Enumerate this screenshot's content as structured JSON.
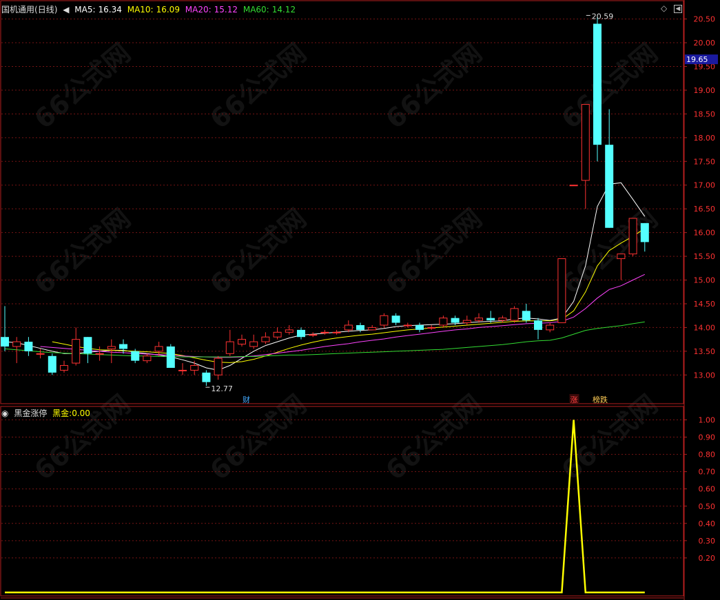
{
  "stock": {
    "name": "国机通用",
    "period": "(日线)"
  },
  "ma_legend": [
    {
      "label": "MA5:",
      "value": "16.34",
      "color": "#ffffff"
    },
    {
      "label": "MA10:",
      "value": "16.09",
      "color": "#ffff00"
    },
    {
      "label": "MA20:",
      "value": "15.12",
      "color": "#ff44ff"
    },
    {
      "label": "MA60:",
      "value": "14.12",
      "color": "#33dd33"
    }
  ],
  "indicator": {
    "name": "黑金涨停",
    "line_label": "黑金:",
    "line_value": "0.00"
  },
  "current_price": "19.65",
  "annotations": {
    "high": "20.59",
    "low": "12.77",
    "fin_mark": "财",
    "up_mark": "涨",
    "list_mark": "榜跌"
  },
  "watermark": "66公式网",
  "colors": {
    "up": "#ff3232",
    "down": "#54ffff",
    "grid": "#781414",
    "frame": "#b41e1e",
    "indicator": "#ffff00"
  },
  "chart_data": [
    {
      "type": "candlestick",
      "title": "国机通用 (日线)",
      "ylim": [
        12.7,
        20.8
      ],
      "yticks": [
        "13.00",
        "13.50",
        "14.00",
        "14.50",
        "15.00",
        "15.50",
        "16.00",
        "16.50",
        "17.00",
        "17.50",
        "18.00",
        "18.50",
        "19.00",
        "19.50",
        "20.00",
        "20.50"
      ],
      "candles": [
        {
          "o": 13.8,
          "c": 13.6,
          "h": 14.45,
          "l": 13.5
        },
        {
          "o": 13.6,
          "c": 13.7,
          "h": 13.8,
          "l": 13.25
        },
        {
          "o": 13.7,
          "c": 13.5,
          "h": 13.8,
          "l": 13.4
        },
        {
          "o": 13.45,
          "c": 13.45,
          "h": 13.55,
          "l": 13.35
        },
        {
          "o": 13.4,
          "c": 13.05,
          "h": 13.45,
          "l": 13.0
        },
        {
          "o": 13.1,
          "c": 13.2,
          "h": 13.3,
          "l": 13.05
        },
        {
          "o": 13.25,
          "c": 13.75,
          "h": 14.0,
          "l": 13.2
        },
        {
          "o": 13.8,
          "c": 13.45,
          "h": 13.8,
          "l": 13.25
        },
        {
          "o": 13.45,
          "c": 13.45,
          "h": 13.6,
          "l": 13.3
        },
        {
          "o": 13.55,
          "c": 13.6,
          "h": 13.75,
          "l": 13.25
        },
        {
          "o": 13.65,
          "c": 13.55,
          "h": 13.75,
          "l": 13.45
        },
        {
          "o": 13.5,
          "c": 13.3,
          "h": 13.55,
          "l": 13.25
        },
        {
          "o": 13.3,
          "c": 13.4,
          "h": 13.45,
          "l": 13.25
        },
        {
          "o": 13.5,
          "c": 13.6,
          "h": 13.7,
          "l": 13.4
        },
        {
          "o": 13.6,
          "c": 13.15,
          "h": 13.65,
          "l": 13.15
        },
        {
          "o": 13.1,
          "c": 13.1,
          "h": 13.25,
          "l": 13.0
        },
        {
          "o": 13.1,
          "c": 13.2,
          "h": 13.3,
          "l": 13.0
        },
        {
          "o": 13.05,
          "c": 12.85,
          "h": 13.1,
          "l": 12.77
        },
        {
          "o": 13.0,
          "c": 13.35,
          "h": 13.4,
          "l": 12.9
        },
        {
          "o": 13.45,
          "c": 13.7,
          "h": 13.95,
          "l": 13.4
        },
        {
          "o": 13.65,
          "c": 13.75,
          "h": 13.85,
          "l": 13.6
        },
        {
          "o": 13.6,
          "c": 13.7,
          "h": 13.85,
          "l": 13.55
        },
        {
          "o": 13.7,
          "c": 13.8,
          "h": 13.9,
          "l": 13.65
        },
        {
          "o": 13.8,
          "c": 13.9,
          "h": 14.0,
          "l": 13.75
        },
        {
          "o": 13.9,
          "c": 13.95,
          "h": 14.05,
          "l": 13.85
        },
        {
          "o": 13.95,
          "c": 13.8,
          "h": 14.0,
          "l": 13.75
        },
        {
          "o": 13.85,
          "c": 13.85,
          "h": 13.9,
          "l": 13.8
        },
        {
          "o": 13.9,
          "c": 13.9,
          "h": 13.95,
          "l": 13.85
        },
        {
          "o": 13.9,
          "c": 13.9,
          "h": 13.95,
          "l": 13.85
        },
        {
          "o": 13.95,
          "c": 14.05,
          "h": 14.15,
          "l": 13.9
        },
        {
          "o": 14.05,
          "c": 13.95,
          "h": 14.1,
          "l": 13.9
        },
        {
          "o": 13.95,
          "c": 14.0,
          "h": 14.05,
          "l": 13.95
        },
        {
          "o": 14.05,
          "c": 14.25,
          "h": 14.3,
          "l": 14.0
        },
        {
          "o": 14.25,
          "c": 14.1,
          "h": 14.3,
          "l": 14.05
        },
        {
          "o": 14.05,
          "c": 14.05,
          "h": 14.1,
          "l": 14.0
        },
        {
          "o": 14.05,
          "c": 13.95,
          "h": 14.1,
          "l": 13.9
        },
        {
          "o": 14.0,
          "c": 14.0,
          "h": 14.05,
          "l": 13.95
        },
        {
          "o": 14.05,
          "c": 14.2,
          "h": 14.25,
          "l": 14.0
        },
        {
          "o": 14.2,
          "c": 14.1,
          "h": 14.25,
          "l": 14.05
        },
        {
          "o": 14.1,
          "c": 14.15,
          "h": 14.25,
          "l": 14.05
        },
        {
          "o": 14.15,
          "c": 14.2,
          "h": 14.3,
          "l": 14.1
        },
        {
          "o": 14.2,
          "c": 14.15,
          "h": 14.35,
          "l": 14.1
        },
        {
          "o": 14.15,
          "c": 14.2,
          "h": 14.25,
          "l": 14.1
        },
        {
          "o": 14.15,
          "c": 14.4,
          "h": 14.45,
          "l": 14.1
        },
        {
          "o": 14.35,
          "c": 14.15,
          "h": 14.5,
          "l": 14.1
        },
        {
          "o": 14.15,
          "c": 13.95,
          "h": 14.2,
          "l": 13.75
        },
        {
          "o": 13.95,
          "c": 14.05,
          "h": 14.1,
          "l": 13.9
        },
        {
          "o": 14.1,
          "c": 15.45,
          "h": 15.45,
          "l": 14.1
        },
        {
          "o": 17.0,
          "c": 17.0,
          "h": 17.0,
          "l": 17.0
        },
        {
          "o": 17.1,
          "c": 18.7,
          "h": 18.7,
          "l": 16.5
        },
        {
          "o": 20.4,
          "c": 17.85,
          "h": 20.59,
          "l": 17.5
        },
        {
          "o": 17.85,
          "c": 16.1,
          "h": 18.6,
          "l": 16.1
        },
        {
          "o": 15.45,
          "c": 15.55,
          "h": 15.55,
          "l": 15.0
        },
        {
          "o": 15.55,
          "c": 16.3,
          "h": 16.3,
          "l": 15.5
        },
        {
          "o": 16.2,
          "c": 15.8,
          "h": 16.2,
          "l": 15.6
        }
      ],
      "ma_series": [
        {
          "name": "MA5",
          "values": [
            13.7,
            13.68,
            13.62,
            13.56,
            13.5,
            13.45,
            13.45,
            13.48,
            13.5,
            13.52,
            13.52,
            13.48,
            13.45,
            13.42,
            13.38,
            13.32,
            13.25,
            13.15,
            13.1,
            13.2,
            13.35,
            13.5,
            13.62,
            13.7,
            13.78,
            13.84,
            13.86,
            13.88,
            13.9,
            13.92,
            13.94,
            13.95,
            13.98,
            14.02,
            14.04,
            14.05,
            14.06,
            14.07,
            14.08,
            14.1,
            14.12,
            14.13,
            14.14,
            14.18,
            14.2,
            14.18,
            14.15,
            14.2,
            14.55,
            15.3,
            16.55,
            17.02,
            17.05,
            16.7,
            16.34
          ]
        },
        {
          "name": "MA10",
          "values": [
            null,
            null,
            null,
            null,
            13.7,
            13.65,
            13.6,
            13.56,
            13.53,
            13.52,
            13.51,
            13.5,
            13.49,
            13.47,
            13.45,
            13.41,
            13.36,
            13.31,
            13.27,
            13.26,
            13.28,
            13.33,
            13.4,
            13.48,
            13.56,
            13.63,
            13.69,
            13.74,
            13.78,
            13.81,
            13.84,
            13.86,
            13.89,
            13.92,
            13.95,
            13.97,
            13.99,
            14.01,
            14.03,
            14.05,
            14.07,
            14.09,
            14.11,
            14.13,
            14.14,
            14.14,
            14.14,
            14.17,
            14.35,
            14.75,
            15.3,
            15.62,
            15.78,
            15.92,
            16.09
          ]
        },
        {
          "name": "MA20",
          "values": [
            null,
            null,
            null,
            13.6,
            13.58,
            13.56,
            13.54,
            13.52,
            13.5,
            13.48,
            13.47,
            13.45,
            13.44,
            13.43,
            13.42,
            13.4,
            13.39,
            13.38,
            13.37,
            13.37,
            13.38,
            13.4,
            13.43,
            13.46,
            13.49,
            13.52,
            13.56,
            13.6,
            13.63,
            13.66,
            13.7,
            13.73,
            13.76,
            13.8,
            13.83,
            13.86,
            13.89,
            13.92,
            13.95,
            13.97,
            14.0,
            14.02,
            14.04,
            14.06,
            14.08,
            14.09,
            14.1,
            14.13,
            14.22,
            14.4,
            14.62,
            14.8,
            14.88,
            15.0,
            15.12
          ]
        },
        {
          "name": "MA60",
          "values": [
            13.55,
            13.53,
            13.51,
            13.49,
            13.47,
            13.46,
            13.45,
            13.44,
            13.43,
            13.42,
            13.41,
            13.4,
            13.4,
            13.39,
            13.39,
            13.38,
            13.38,
            13.38,
            13.38,
            13.38,
            13.39,
            13.39,
            13.4,
            13.41,
            13.42,
            13.42,
            13.43,
            13.44,
            13.45,
            13.46,
            13.47,
            13.48,
            13.49,
            13.5,
            13.51,
            13.52,
            13.53,
            13.54,
            13.56,
            13.58,
            13.6,
            13.62,
            13.64,
            13.67,
            13.7,
            13.72,
            13.73,
            13.78,
            13.86,
            13.94,
            13.98,
            14.01,
            14.04,
            14.08,
            14.12
          ]
        }
      ]
    },
    {
      "type": "line",
      "title": "黑金涨停",
      "ylim": [
        0,
        1.05
      ],
      "yticks": [
        "0.20",
        "0.30",
        "0.40",
        "0.50",
        "0.60",
        "0.70",
        "0.80",
        "0.90",
        "1.00"
      ],
      "series": [
        {
          "name": "黑金",
          "values": [
            0,
            0,
            0,
            0,
            0,
            0,
            0,
            0,
            0,
            0,
            0,
            0,
            0,
            0,
            0,
            0,
            0,
            0,
            0,
            0,
            0,
            0,
            0,
            0,
            0,
            0,
            0,
            0,
            0,
            0,
            0,
            0,
            0,
            0,
            0,
            0,
            0,
            0,
            0,
            0,
            0,
            0,
            0,
            0,
            0,
            0,
            0,
            0,
            1,
            0,
            0,
            0,
            0,
            0,
            0
          ]
        }
      ]
    }
  ]
}
